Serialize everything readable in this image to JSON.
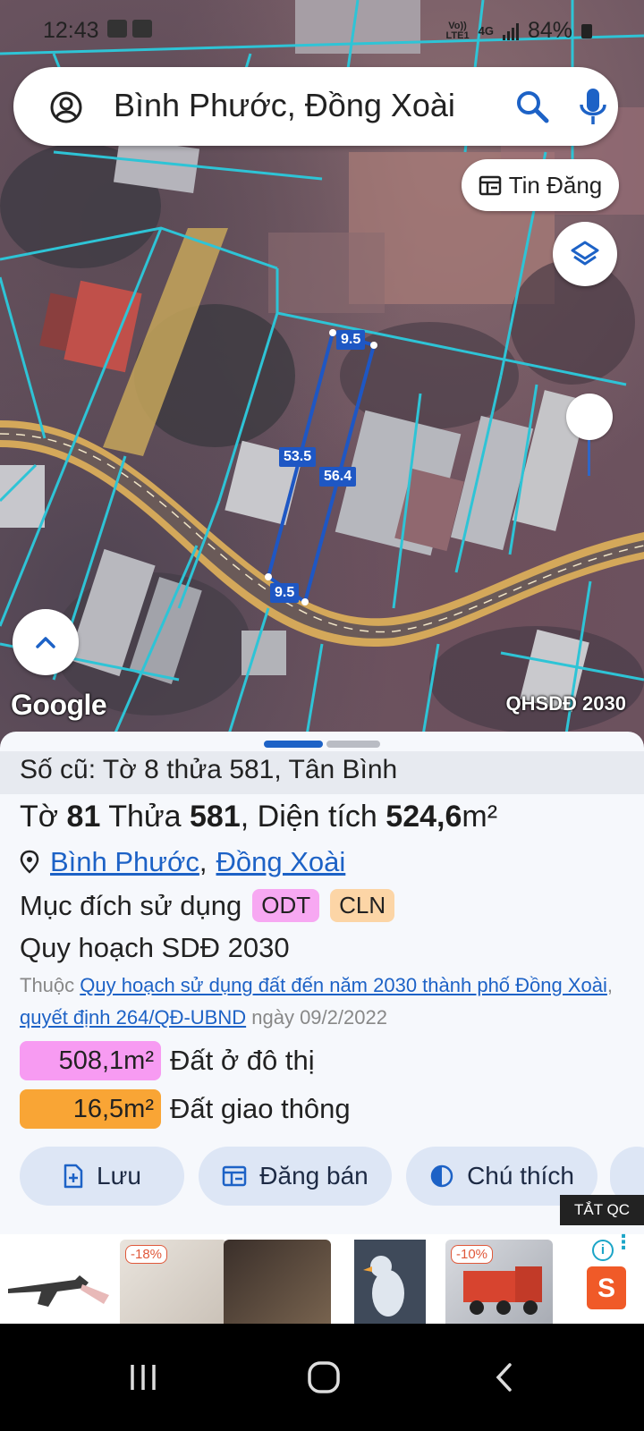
{
  "status": {
    "time": "12:43",
    "net_top": "Vo))",
    "net_bottom": "LTE1",
    "net_type": "4G",
    "battery": "84%"
  },
  "search": {
    "query": "Bình Phước, Đồng Xoài"
  },
  "map": {
    "tin_dang_label": "Tin Đăng",
    "google_label": "Google",
    "layer_name": "QHSDĐ 2030",
    "dimensions": {
      "top": "9.5",
      "left": "53.5",
      "right": "56.4",
      "bottom": "9.5"
    }
  },
  "sheet": {
    "old_parcel": "Số cũ: Tờ 8 thửa 581, Tân Bình",
    "title": {
      "to_label": "Tờ",
      "to_value": "81",
      "thua_label": "Thửa",
      "thua_value": "581",
      "area_label": "Diện tích",
      "area_value": "524,6",
      "area_unit": "m²"
    },
    "location": {
      "province": "Bình Phước",
      "separator": ",",
      "city": "Đồng Xoài"
    },
    "purpose": {
      "label": "Mục đích sử dụng",
      "tags": [
        {
          "code": "ODT",
          "color": "#f7a8f2"
        },
        {
          "code": "CLN",
          "color": "#fcd5a6"
        }
      ]
    },
    "plan": {
      "title": "Quy hoạch SDĐ 2030",
      "prefix": "Thuộc",
      "link1": "Quy hoạch sử dụng đất đến năm 2030 thành phố Đồng Xoài",
      "comma": ",",
      "link2": "quyết định 264/QĐ-UBND",
      "date": "ngày 09/2/2022"
    },
    "areas": [
      {
        "value": "508,1m²",
        "label": "Đất ở đô thị",
        "color": "#f79bf2"
      },
      {
        "value": "16,5m²",
        "label": "Đất giao thông",
        "color": "#f9a535"
      }
    ],
    "actions": [
      {
        "label": "Lưu",
        "icon": "file-add-icon"
      },
      {
        "label": "Đăng bán",
        "icon": "listing-icon"
      },
      {
        "label": "Chú thích",
        "icon": "contrast-icon"
      }
    ],
    "ad_close": "TẮT QC"
  },
  "ads": {
    "items": [
      {
        "badge": ""
      },
      {
        "badge": "-18%"
      },
      {
        "badge": ""
      },
      {
        "badge": ""
      },
      {
        "badge": "-10%"
      }
    ],
    "info": "i",
    "brand_letter": "S"
  },
  "colors": {
    "accent": "#1d62c6",
    "chip_bg": "#dde6f5",
    "parcel_line": "#2ec4d6",
    "dimension": "#1e57c4"
  }
}
